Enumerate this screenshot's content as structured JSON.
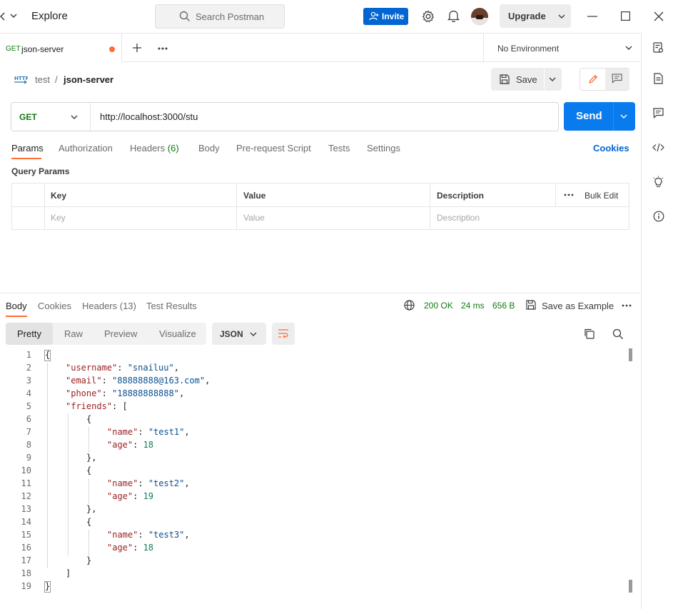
{
  "topbar": {
    "nav_label": "Explore",
    "search_placeholder": "Search Postman",
    "invite_label": "Invite",
    "upgrade_label": "Upgrade"
  },
  "tabs": {
    "active_method": "GET",
    "active_title": "json-server",
    "environment": "No Environment"
  },
  "request": {
    "workspace": "test",
    "separator": "/",
    "name": "json-server",
    "save_label": "Save",
    "method": "GET",
    "url": "http://localhost:3000/stu",
    "send_label": "Send",
    "tabs": [
      "Params",
      "Authorization",
      "Headers",
      "Body",
      "Pre-request Script",
      "Tests",
      "Settings"
    ],
    "headers_count": "(6)",
    "cookies_label": "Cookies",
    "query_params_title": "Query Params",
    "table_headers": [
      "Key",
      "Value",
      "Description"
    ],
    "bulk_edit_label": "Bulk Edit",
    "placeholders": [
      "Key",
      "Value",
      "Description"
    ]
  },
  "response": {
    "tabs": [
      "Body",
      "Cookies",
      "Headers (13)",
      "Test Results"
    ],
    "status": "200 OK",
    "time": "24 ms",
    "size": "656 B",
    "save_example_label": "Save as Example",
    "view_tabs": [
      "Pretty",
      "Raw",
      "Preview",
      "Visualize"
    ],
    "format": "JSON",
    "code_lines": [
      [
        [
          "p",
          "{"
        ]
      ],
      [
        [
          "k",
          "\"username\""
        ],
        [
          "p",
          ": "
        ],
        [
          "s",
          "\"snailuu\""
        ],
        [
          "p",
          ","
        ]
      ],
      [
        [
          "k",
          "\"email\""
        ],
        [
          "p",
          ": "
        ],
        [
          "s",
          "\"88888888@163.com\""
        ],
        [
          "p",
          ","
        ]
      ],
      [
        [
          "k",
          "\"phone\""
        ],
        [
          "p",
          ": "
        ],
        [
          "s",
          "\"18888888888\""
        ],
        [
          "p",
          ","
        ]
      ],
      [
        [
          "k",
          "\"friends\""
        ],
        [
          "p",
          ": ["
        ]
      ],
      [
        [
          "p",
          "{"
        ]
      ],
      [
        [
          "k",
          "\"name\""
        ],
        [
          "p",
          ": "
        ],
        [
          "s",
          "\"test1\""
        ],
        [
          "p",
          ","
        ]
      ],
      [
        [
          "k",
          "\"age\""
        ],
        [
          "p",
          ": "
        ],
        [
          "n",
          "18"
        ]
      ],
      [
        [
          "p",
          "},"
        ]
      ],
      [
        [
          "p",
          "{"
        ]
      ],
      [
        [
          "k",
          "\"name\""
        ],
        [
          "p",
          ": "
        ],
        [
          "s",
          "\"test2\""
        ],
        [
          "p",
          ","
        ]
      ],
      [
        [
          "k",
          "\"age\""
        ],
        [
          "p",
          ": "
        ],
        [
          "n",
          "19"
        ]
      ],
      [
        [
          "p",
          "},"
        ]
      ],
      [
        [
          "p",
          "{"
        ]
      ],
      [
        [
          "k",
          "\"name\""
        ],
        [
          "p",
          ": "
        ],
        [
          "s",
          "\"test3\""
        ],
        [
          "p",
          ","
        ]
      ],
      [
        [
          "k",
          "\"age\""
        ],
        [
          "p",
          ": "
        ],
        [
          "n",
          "18"
        ]
      ],
      [
        [
          "p",
          "}"
        ]
      ],
      [
        [
          "p",
          "]"
        ]
      ],
      [
        [
          "p",
          "}"
        ]
      ]
    ]
  },
  "colors": {
    "accent": "#ff6c37",
    "send": "#097bed",
    "get_method": "#0f7b0f",
    "link": "#0265d2"
  }
}
